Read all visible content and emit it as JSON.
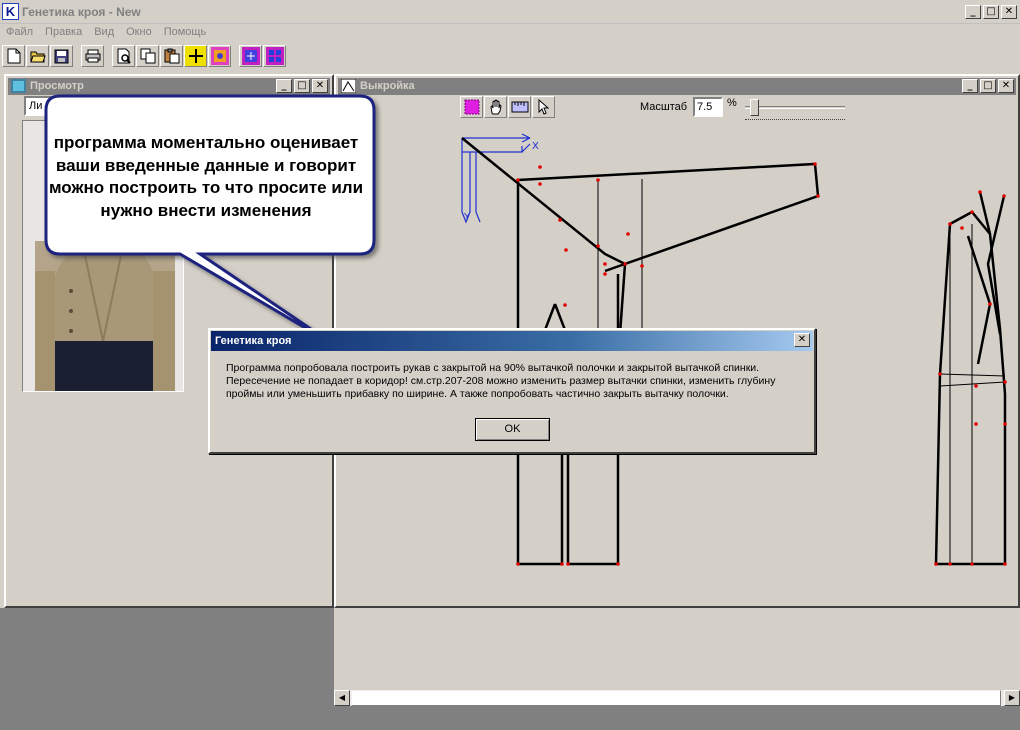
{
  "app": {
    "title": "Генетика кроя - New",
    "icon_letter": "K"
  },
  "menu": [
    "Файл",
    "Правка",
    "Вид",
    "Окно",
    "Помощь"
  ],
  "toolbar_icons": [
    "new-file-icon",
    "open-folder-icon",
    "save-icon",
    "print-icon",
    "print-preview-icon",
    "copy-icon",
    "paste-icon",
    "crosshair-icon",
    "figure-icon",
    "pattern-icon",
    "grid-icon"
  ],
  "preview_window": {
    "title": "Просмотр",
    "combo_value": "Ли"
  },
  "pattern_window": {
    "title": "Выкройка",
    "tools": [
      "select-rect-icon",
      "hand-icon",
      "ruler-icon",
      "pointer-icon"
    ],
    "scale_label": "Масштаб",
    "scale_value": "7.5",
    "scale_unit": "%",
    "axis_x": "X",
    "axis_y": "Y"
  },
  "callout": {
    "text": "программа моментально оценивает ваши введенные данные и говорит можно построить то что просите или нужно внести изменения"
  },
  "dialog": {
    "title": "Генетика кроя",
    "message_lines": [
      "Программа попробовала построить рукав с закрытой на 90% вытачкой полочки и закрытой вытачкой спинки.",
      "Пересечение не попадает в коридор! см.стр.207-208 можно изменить размер вытачки спинки, изменить глубину",
      "проймы или уменьшить прибавку по ширине. А также попробовать частично закрыть вытачку полочки."
    ],
    "ok_label": "OK"
  },
  "colors": {
    "dialog_title_start": "#0a246a",
    "dialog_title_end": "#a6caf0",
    "callout_fill": "#ffffff",
    "callout_border": "#1a237e",
    "pattern_points": "#e00000"
  }
}
